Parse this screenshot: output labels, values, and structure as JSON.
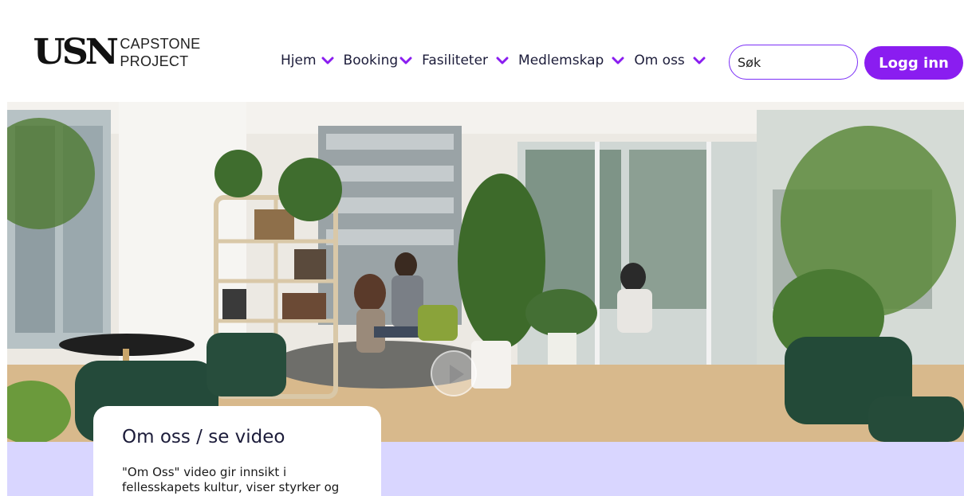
{
  "header": {
    "logo_mark": "USN",
    "logo_line1": "CAPSTONE",
    "logo_line2": "PROJECT",
    "nav": [
      {
        "label": "Hjem"
      },
      {
        "label": "Booking"
      },
      {
        "label": "Fasiliteter"
      },
      {
        "label": "Medlemskap"
      },
      {
        "label": "Om oss"
      }
    ],
    "search_placeholder": "Søk",
    "login_label": "Logg inn"
  },
  "hero": {
    "image": "office lounge with plants, bookshelf, people at desk",
    "play_icon": "play-icon"
  },
  "card": {
    "title": "Om oss / se video",
    "text": "\"Om Oss\" video gir innsikt i fellesskapets kultur, viser styrker og"
  },
  "colors": {
    "accent": "#8a1df0",
    "nav_text": "#1c1c3a",
    "band": "#d9d6ff"
  }
}
